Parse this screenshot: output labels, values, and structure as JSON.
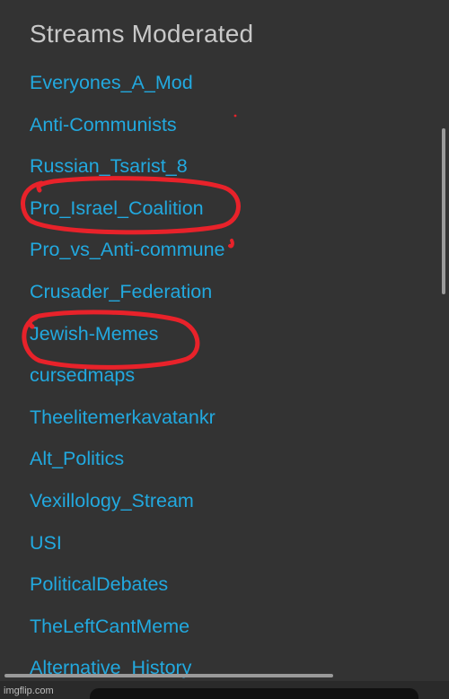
{
  "page": {
    "title": "Streams Moderated",
    "watermark": "imgflip.com"
  },
  "streams": [
    "Everyones_A_Mod",
    "Anti-Communists",
    "Russian_Tsarist_8",
    "Pro_Israel_Coalition",
    "Pro_vs_Anti-commune",
    "Crusader_Federation",
    "Jewish-Memes",
    "cursedmaps",
    "Theelitemerkavatankr",
    "Alt_Politics",
    "Vexillology_Stream",
    "USI",
    "PoliticalDebates",
    "TheLeftCantMeme",
    "Alternative_History"
  ],
  "colors": {
    "background": "#333333",
    "title": "#c8c8c8",
    "link": "#22a9df",
    "annotation": "#e8222a"
  }
}
